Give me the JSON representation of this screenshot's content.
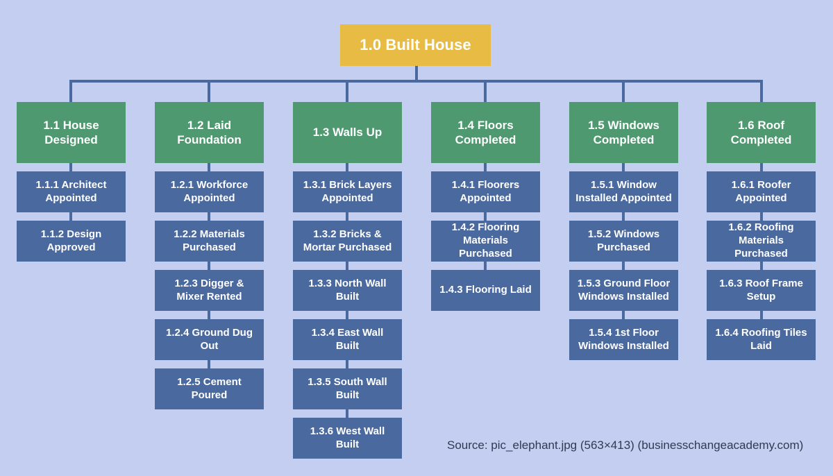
{
  "diagram": {
    "type": "work-breakdown-structure",
    "background_color": "#c3cef0",
    "colors": {
      "root": "#e8bc44",
      "phase": "#4e9970",
      "task": "#4a699f",
      "connector": "#4a699f",
      "node_text": "#ffffff",
      "caption_text": "#2f3b52"
    },
    "root": {
      "id": "1.0",
      "label": "1.0 Built House"
    },
    "columns": [
      {
        "phase": {
          "id": "1.1",
          "label": "1.1 House\nDesigned"
        },
        "tasks": [
          {
            "id": "1.1.1",
            "label": "1.1.1 Architect\nAppointed"
          },
          {
            "id": "1.1.2",
            "label": "1.1.2 Design\nApproved"
          }
        ]
      },
      {
        "phase": {
          "id": "1.2",
          "label": "1.2 Laid\nFoundation"
        },
        "tasks": [
          {
            "id": "1.2.1",
            "label": "1.2.1 Workforce\nAppointed"
          },
          {
            "id": "1.2.2",
            "label": "1.2.2 Materials\nPurchased"
          },
          {
            "id": "1.2.3",
            "label": "1.2.3 Digger &\nMixer Rented"
          },
          {
            "id": "1.2.4",
            "label": "1.2.4 Ground Dug\nOut"
          },
          {
            "id": "1.2.5",
            "label": "1.2.5 Cement\nPoured"
          }
        ]
      },
      {
        "phase": {
          "id": "1.3",
          "label": "1.3 Walls Up"
        },
        "tasks": [
          {
            "id": "1.3.1",
            "label": "1.3.1 Brick Layers\nAppointed"
          },
          {
            "id": "1.3.2",
            "label": "1.3.2 Bricks &\nMortar Purchased"
          },
          {
            "id": "1.3.3",
            "label": "1.3.3 North Wall\nBuilt"
          },
          {
            "id": "1.3.4",
            "label": "1.3.4 East Wall\nBuilt"
          },
          {
            "id": "1.3.5",
            "label": "1.3.5 South Wall\nBuilt"
          },
          {
            "id": "1.3.6",
            "label": "1.3.6 West Wall\nBuilt"
          }
        ]
      },
      {
        "phase": {
          "id": "1.4",
          "label": "1.4 Floors\nCompleted"
        },
        "tasks": [
          {
            "id": "1.4.1",
            "label": "1.4.1 Floorers\nAppointed"
          },
          {
            "id": "1.4.2",
            "label": "1.4.2 Flooring\nMaterials Purchased"
          },
          {
            "id": "1.4.3",
            "label": "1.4.3 Flooring Laid"
          }
        ]
      },
      {
        "phase": {
          "id": "1.5",
          "label": "1.5 Windows\nCompleted"
        },
        "tasks": [
          {
            "id": "1.5.1",
            "label": "1.5.1 Window\nInstalled Appointed"
          },
          {
            "id": "1.5.2",
            "label": "1.5.2 Windows\nPurchased"
          },
          {
            "id": "1.5.3",
            "label": "1.5.3 Ground Floor\nWindows Installed"
          },
          {
            "id": "1.5.4",
            "label": "1.5.4 1st Floor\nWindows Installed"
          }
        ]
      },
      {
        "phase": {
          "id": "1.6",
          "label": "1.6 Roof\nCompleted"
        },
        "tasks": [
          {
            "id": "1.6.1",
            "label": "1.6.1 Roofer\nAppointed"
          },
          {
            "id": "1.6.2",
            "label": "1.6.2 Roofing\nMaterials Purchased"
          },
          {
            "id": "1.6.3",
            "label": "1.6.3 Roof Frame\nSetup"
          },
          {
            "id": "1.6.4",
            "label": "1.6.4 Roofing Tiles\nLaid"
          }
        ]
      }
    ],
    "caption": "Source: pic_elephant.jpg (563×413) (businesschangeacademy.com)"
  }
}
